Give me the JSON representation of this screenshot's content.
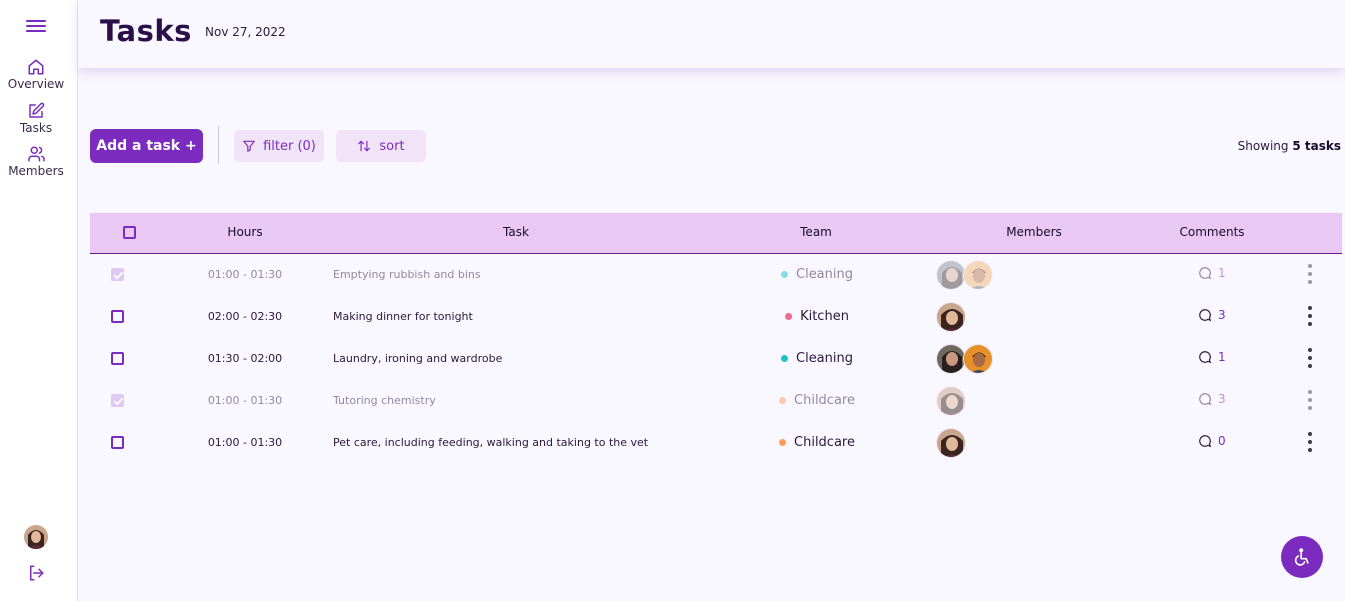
{
  "nav": {
    "items": [
      {
        "label": "Overview",
        "icon": "home-icon"
      },
      {
        "label": "Tasks",
        "icon": "edit-icon"
      },
      {
        "label": "Members",
        "icon": "users-icon"
      }
    ]
  },
  "header": {
    "title": "Tasks",
    "date": "Nov 27, 2022"
  },
  "toolbar": {
    "add_label": "Add a task +",
    "filter_label": "filter (0)",
    "sort_label": "sort",
    "showing_prefix": "Showing",
    "showing_count": "5 tasks"
  },
  "table": {
    "columns": [
      "Hours",
      "Task",
      "Team",
      "Members",
      "Comments"
    ],
    "rows": [
      {
        "done": true,
        "hours": "01:00 - 01:30",
        "task": "Emptying rubbish and bins",
        "team": "Cleaning",
        "comments": "1"
      },
      {
        "done": false,
        "hours": "02:00 - 02:30",
        "task": "Making dinner for tonight",
        "team": "Kitchen",
        "comments": "3"
      },
      {
        "done": false,
        "hours": "01:30 - 02:00",
        "task": "Laundry, ironing and wardrobe",
        "team": "Cleaning",
        "comments": "1"
      },
      {
        "done": true,
        "hours": "01:00 - 01:30",
        "task": "Tutoring chemistry",
        "team": "Childcare",
        "comments": "3"
      },
      {
        "done": false,
        "hours": "01:00 - 01:30",
        "task": "Pet care, including feeding, walking and taking to the vet",
        "team": "Childcare",
        "comments": "0"
      }
    ]
  },
  "colors": {
    "accent": "#7b2cbf",
    "header_row": "#e9c9f3",
    "team_cleaning": "#1cc3c9",
    "team_kitchen": "#f06a8a",
    "team_childcare": "#ff9c5a"
  },
  "icons": [
    "menu-icon",
    "home-icon",
    "edit-icon",
    "users-icon",
    "logout-icon",
    "filter-icon",
    "sort-icon",
    "comment-icon",
    "more-vertical-icon",
    "accessibility-icon"
  ]
}
